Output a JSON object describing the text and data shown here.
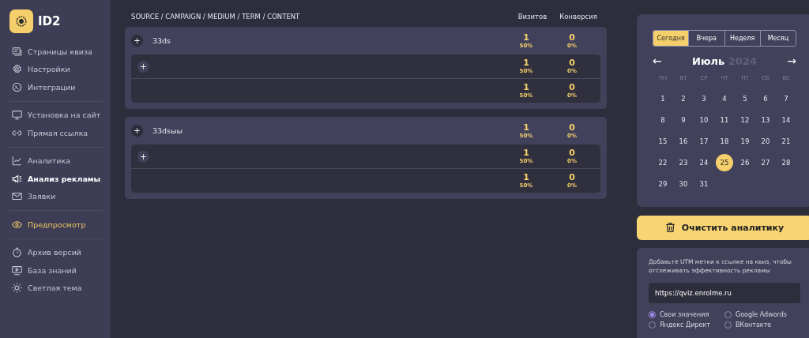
{
  "brand": {
    "name": "ID2"
  },
  "sidebar": {
    "sections": [
      [
        {
          "label": "Страницы квиза",
          "selected": false,
          "kind": "normal"
        },
        {
          "label": "Настройки",
          "selected": false,
          "kind": "normal"
        },
        {
          "label": "Интеграции",
          "selected": false,
          "kind": "normal"
        }
      ],
      [
        {
          "label": "Установка на сайт",
          "selected": false,
          "kind": "normal"
        },
        {
          "label": "Прямая ссылка",
          "selected": false,
          "kind": "normal"
        }
      ],
      [
        {
          "label": "Аналитика",
          "selected": false,
          "kind": "normal"
        },
        {
          "label": "Анализ рекламы",
          "selected": true,
          "kind": "normal"
        },
        {
          "label": "Заявки",
          "selected": false,
          "kind": "normal"
        }
      ],
      [
        {
          "label": "Предпросмотр",
          "selected": false,
          "kind": "accent"
        }
      ],
      [
        {
          "label": "Архив версий",
          "selected": false,
          "kind": "normal"
        },
        {
          "label": "База знаний",
          "selected": false,
          "kind": "normal"
        },
        {
          "label": "Светлая тема",
          "selected": false,
          "kind": "normal"
        }
      ]
    ]
  },
  "table": {
    "columns": [
      "SOURCE / CAMPAIGN / MEDIUM / TERM / CONTENT",
      "Визитов",
      "Конверсия"
    ],
    "groups": [
      {
        "name": "33ds",
        "expand": "+",
        "visits": "1",
        "visits_share": "50%",
        "conversion": "0",
        "conversion_share": "0%",
        "rows": [
          {
            "kind": "expandable",
            "expand": "+",
            "visits": "1",
            "visits_share": "50%",
            "conversion": "0",
            "conversion_share": "0%"
          },
          {
            "kind": "leaf",
            "visits": "1",
            "visits_share": "50%",
            "conversion": "0",
            "conversion_share": "0%"
          }
        ]
      },
      {
        "name": "33dsыы",
        "expand": "+",
        "visits": "1",
        "visits_share": "50%",
        "conversion": "0",
        "conversion_share": "0%",
        "rows": [
          {
            "kind": "expandable",
            "expand": "+",
            "visits": "1",
            "visits_share": "50%",
            "conversion": "0",
            "conversion_share": "0%"
          },
          {
            "kind": "leaf",
            "visits": "1",
            "visits_share": "50%",
            "conversion": "0",
            "conversion_share": "0%"
          }
        ]
      }
    ]
  },
  "calendar": {
    "ranges": [
      {
        "label": "Сегодня",
        "selected": true
      },
      {
        "label": "Вчера",
        "selected": false
      },
      {
        "label": "Неделя",
        "selected": false
      },
      {
        "label": "Месяц",
        "selected": false
      }
    ],
    "prev": "←",
    "next": "→",
    "month": "Июль",
    "year": "2024",
    "weekdays": [
      "ПН",
      "ВТ",
      "СР",
      "ЧТ",
      "ПТ",
      "СБ",
      "ВС"
    ],
    "days": [
      {
        "day": "1",
        "selected": false
      },
      {
        "day": "2",
        "selected": false
      },
      {
        "day": "3",
        "selected": false
      },
      {
        "day": "4",
        "selected": false
      },
      {
        "day": "5",
        "selected": false
      },
      {
        "day": "6",
        "selected": false
      },
      {
        "day": "7",
        "selected": false
      },
      {
        "day": "8",
        "selected": false
      },
      {
        "day": "9",
        "selected": false
      },
      {
        "day": "10",
        "selected": false
      },
      {
        "day": "11",
        "selected": false
      },
      {
        "day": "12",
        "selected": false
      },
      {
        "day": "13",
        "selected": false
      },
      {
        "day": "14",
        "selected": false
      },
      {
        "day": "15",
        "selected": false
      },
      {
        "day": "16",
        "selected": false
      },
      {
        "day": "17",
        "selected": false
      },
      {
        "day": "18",
        "selected": false
      },
      {
        "day": "19",
        "selected": false
      },
      {
        "day": "20",
        "selected": false
      },
      {
        "day": "21",
        "selected": false
      },
      {
        "day": "22",
        "selected": false
      },
      {
        "day": "23",
        "selected": false
      },
      {
        "day": "24",
        "selected": false
      },
      {
        "day": "25",
        "selected": true
      },
      {
        "day": "26",
        "selected": false
      },
      {
        "day": "27",
        "selected": false
      },
      {
        "day": "28",
        "selected": false
      },
      {
        "day": "29",
        "selected": false
      },
      {
        "day": "30",
        "selected": false
      },
      {
        "day": "31",
        "selected": false
      }
    ]
  },
  "clear_button": {
    "label": "Очистить аналитику"
  },
  "utm": {
    "hint": "Добавьте UTM метки к ссылке на квиз, чтобы отслеживать эффективность рекламы",
    "url": "https://qviz.enrolme.ru",
    "options": [
      {
        "label": "Свои значения",
        "selected": true
      },
      {
        "label": "Google Adwords",
        "selected": false
      },
      {
        "label": "Яндекс Директ",
        "selected": false
      },
      {
        "label": "ВКонтакте",
        "selected": false
      }
    ]
  }
}
